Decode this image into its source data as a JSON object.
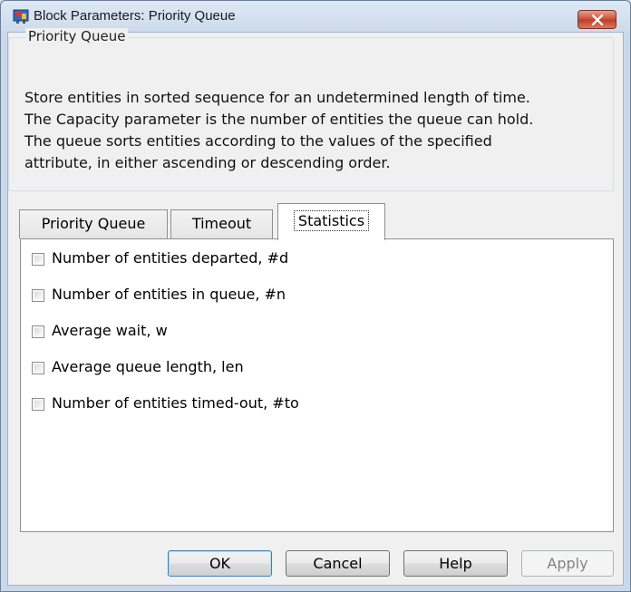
{
  "window": {
    "title": "Block Parameters: Priority Queue",
    "accent_color": "#c9d8ea",
    "close_color": "#c7432b"
  },
  "group": {
    "legend": "Priority Queue",
    "description": [
      "Store entities in sorted sequence for an undetermined length of time.",
      "The Capacity parameter is the number of entities the queue can hold.",
      "The queue sorts entities according to the values of the specified",
      "attribute, in either ascending or descending order."
    ]
  },
  "tabs": [
    {
      "label": "Priority Queue",
      "active": false
    },
    {
      "label": "Timeout",
      "active": false
    },
    {
      "label": "Statistics",
      "active": true
    }
  ],
  "statistics": [
    {
      "label": "Number of entities departed, #d",
      "checked": false
    },
    {
      "label": "Number of entities in queue, #n",
      "checked": false
    },
    {
      "label": "Average wait, w",
      "checked": false
    },
    {
      "label": "Average queue length, len",
      "checked": false
    },
    {
      "label": "Number of entities timed-out, #to",
      "checked": false
    }
  ],
  "buttons": {
    "ok": "OK",
    "cancel": "Cancel",
    "help": "Help",
    "apply": "Apply"
  }
}
